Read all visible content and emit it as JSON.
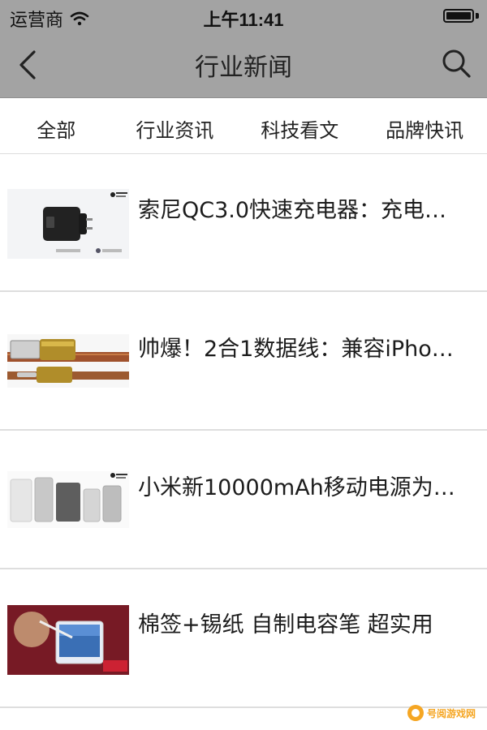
{
  "status_bar": {
    "carrier": "运营商",
    "time": "上午11:41"
  },
  "nav": {
    "title": "行业新闻"
  },
  "tabs": [
    {
      "label": "全部"
    },
    {
      "label": "行业资讯"
    },
    {
      "label": "科技看文"
    },
    {
      "label": "品牌快讯"
    }
  ],
  "news": [
    {
      "title": "索尼QC3.0快速充电器：充电…",
      "thumb": "charger-image"
    },
    {
      "title": "帅爆！2合1数据线：兼容iPho…",
      "thumb": "cable-image"
    },
    {
      "title": "小米新10000mAh移动电源为…",
      "thumb": "power-bank-image"
    },
    {
      "title": "棉签+锡纸 自制电容笔 超实用",
      "thumb": "stylus-image"
    }
  ],
  "watermark": {
    "text": "号阅游戏网"
  }
}
